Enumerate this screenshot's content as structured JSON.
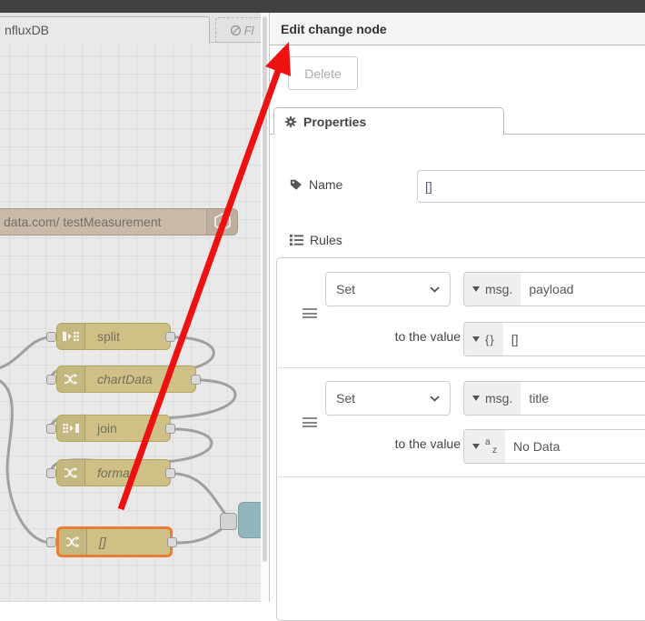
{
  "colors": {
    "node_khaki": "#cfc186",
    "node_selected_border": "#ea7d33",
    "influx_node_tan": "#c9b9a9",
    "ui_node_teal": "#8fb6bb",
    "wire_gray": "#a0a0a0",
    "annotation_arrow_red": "#ee1111",
    "topbar_dark": "#414141"
  },
  "workspace": {
    "active_tab_label": "nfluxDB",
    "disabled_tab_label": "Fl",
    "influx_node_label": "data.com/ testMeasurement",
    "nodes": [
      {
        "label": "split"
      },
      {
        "label": "chartData"
      },
      {
        "label": "join"
      },
      {
        "label": "format"
      },
      {
        "label": "[]"
      }
    ]
  },
  "tray": {
    "title": "Edit change node",
    "delete_button_label": "Delete",
    "properties_tab_label": "Properties",
    "form": {
      "name_label": "Name",
      "name_value": "[]",
      "rules_label": "Rules",
      "rules": [
        {
          "action": "Set",
          "target_prefix": "msg.",
          "target_property": "payload",
          "to_label": "to the value",
          "value_type_glyph": "{}",
          "value": "[]"
        },
        {
          "action": "Set",
          "target_prefix": "msg.",
          "target_property": "title",
          "to_label": "to the value",
          "value_type_glyph_top": "a",
          "value_type_glyph_bottom": "z",
          "value": "No Data"
        }
      ]
    }
  }
}
